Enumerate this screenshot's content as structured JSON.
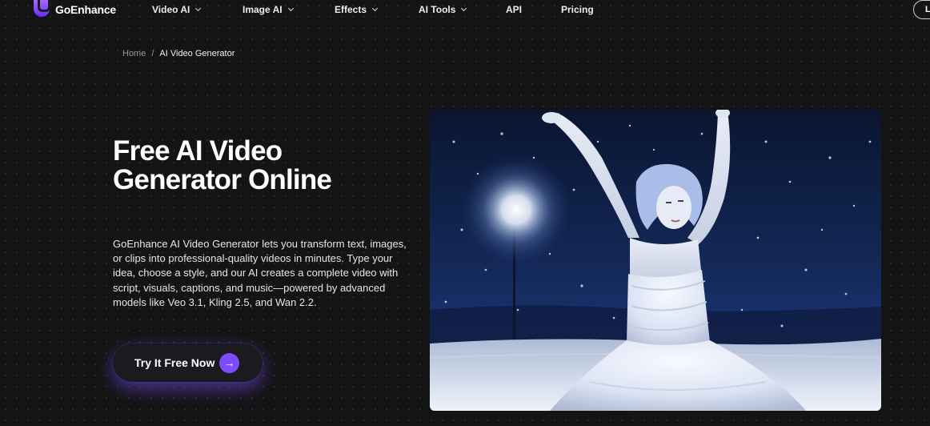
{
  "brand": {
    "name": "GoEnhance"
  },
  "nav": {
    "items": [
      {
        "label": "Video AI",
        "dropdown": true
      },
      {
        "label": "Image AI",
        "dropdown": true
      },
      {
        "label": "Effects",
        "dropdown": true
      },
      {
        "label": "AI Tools",
        "dropdown": true
      },
      {
        "label": "API",
        "dropdown": false
      },
      {
        "label": "Pricing",
        "dropdown": false
      }
    ],
    "login_label": "L"
  },
  "breadcrumb": {
    "home": "Home",
    "separator": "/",
    "current": "AI Video Generator"
  },
  "hero": {
    "title": "Free AI Video Generator Online",
    "description": "GoEnhance AI Video Generator lets you transform text, images, or clips into professional-quality videos in minutes. Type your idea, choose a style, and our AI creates a complete video with script, visuals, captions, and music—powered by advanced models like Veo 3.1, Kling 2.5, and Wan 2.2.",
    "cta_label": "Try It Free Now",
    "cta_icon": "→"
  },
  "colors": {
    "accent": "#7b4dff",
    "background": "#141414"
  }
}
